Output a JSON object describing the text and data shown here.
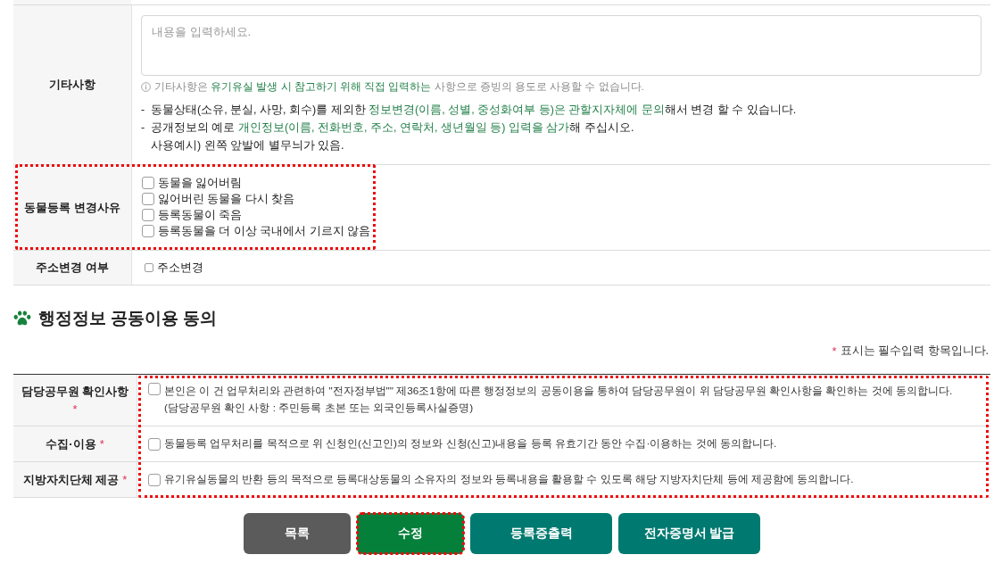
{
  "remarks": {
    "label": "기타사항",
    "placeholder": "내용을 입력하세요.",
    "hint": [
      {
        "text": "기타사항은 ",
        "emphasis": false
      },
      {
        "text": "유기유실 발생 시 참고하기 위해 직접 입력하는",
        "emphasis": true
      },
      {
        "text": " 사항으로 증빙의 용도로 사용할 수 없습니다.",
        "emphasis": false
      }
    ],
    "notes": [
      {
        "marker": "-",
        "lines": [
          [
            {
              "text": "동물상태(소유, 분실, 사망, 회수)를 제외한 ",
              "emphasis": false
            },
            {
              "text": "정보변경(이름, 성별, 중성화여부 등)은 관할지자체에 문의",
              "emphasis": true
            },
            {
              "text": "해서 변경 할 수 있습니다.",
              "emphasis": false
            }
          ]
        ]
      },
      {
        "marker": "-",
        "lines": [
          [
            {
              "text": "공개정보의 예로 ",
              "emphasis": false
            },
            {
              "text": "개인정보(이름, 전화번호, 주소, 연락처, 생년월일 등) 입력을 삼가",
              "emphasis": true
            },
            {
              "text": "해 주십시오.",
              "emphasis": false
            }
          ],
          [
            {
              "text": "사용예시) 왼쪽 앞발에 별무늬가 있음.",
              "emphasis": false
            }
          ]
        ]
      }
    ]
  },
  "change_reason": {
    "label": "동물등록 변경사유",
    "highlighted": true,
    "options": [
      {
        "label": "동물을 잃어버림",
        "checked": false
      },
      {
        "label": "잃어버린 동물을 다시 찾음",
        "checked": false
      },
      {
        "label": "등록동물이 죽음",
        "checked": false
      },
      {
        "label": "등록동물을 더 이상 국내에서 기르지 않음",
        "checked": false
      }
    ]
  },
  "address_change": {
    "label": "주소변경 여부",
    "options": [
      {
        "label": "주소변경",
        "checked": false
      }
    ]
  },
  "consent_section": {
    "title": "행정정보 공동이용 동의",
    "required_note": {
      "mark": "*",
      "text": "표시는 필수입력 항목입니다."
    },
    "highlighted": true,
    "rows": [
      {
        "label": "담당공무원 확인사항",
        "required_mark": "*",
        "checked": false,
        "lines": [
          "본인은 이 건 업무처리와 관련하여 \"전자정부법\"\" 제36조1항에 따른 행정정보의 공동이용을 통하여 담당공무원이 위 담당공무원 확인사항을 확인하는 것에 동의합니다.",
          "(담당공무원 확인 사항 : 주민등록 초본 또는 외국인등록사실증명)"
        ]
      },
      {
        "label": "수집·이용",
        "required_mark": "*",
        "checked": false,
        "lines": [
          "동물등록 업무처리를 목적으로 위 신청인(신고인)의 정보와 신청(신고)내용을 등록 유효기간 동안 수집·이용하는 것에 동의합니다."
        ]
      },
      {
        "label": "지방자치단체 제공",
        "required_mark": "*",
        "checked": false,
        "lines": [
          "유기유실동물의 반환 등의 목적으로 등록대상동물의 소유자의 정보와 등록내용을 활용할 수 있도록 해당 지방자치단체 등에 제공함에 동의합니다."
        ]
      }
    ]
  },
  "buttons": [
    {
      "label": "목록",
      "kind": "secondary",
      "highlighted": false
    },
    {
      "label": "수정",
      "kind": "primary",
      "highlighted": true
    },
    {
      "label": "등록증출력",
      "kind": "action",
      "highlighted": false
    },
    {
      "label": "전자증명서 발급",
      "kind": "action",
      "highlighted": false
    }
  ]
}
